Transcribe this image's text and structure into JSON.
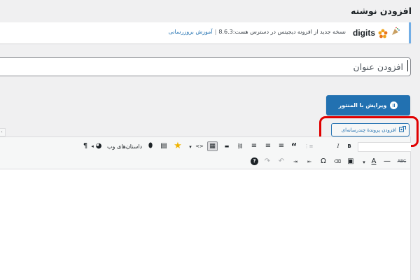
{
  "page": {
    "title": "افزودن نوشته"
  },
  "notice": {
    "brand": "digits",
    "message": "نسخه جدید از افزونه دیجیتس در دسترس هست:8.6.3",
    "separator": "|",
    "link": "آموزش بروزرسانی"
  },
  "title_field": {
    "placeholder": "افزودن عنوان"
  },
  "elementor": {
    "label": "ویرایش با المنتور"
  },
  "media": {
    "label": "افزودن پروندهٔ چندرسانه‌ای"
  },
  "toolbar": {
    "row1": [
      {
        "name": "paragraph-icon",
        "glyph": "¶"
      },
      {
        "name": "rtl-icon",
        "glyph": "◂"
      },
      {
        "name": "pie-chart-icon",
        "glyph": "◕"
      },
      {
        "name": "web-stories-label",
        "text": "داستان‌های وب"
      },
      {
        "name": "web-stories-icon",
        "glyph": "⬮"
      },
      {
        "name": "table-icon",
        "glyph": "▤"
      },
      {
        "name": "star-icon",
        "glyph": "★"
      },
      {
        "name": "dropdown-arrow-icon",
        "glyph": "▾"
      },
      {
        "name": "code-icon",
        "glyph": "<>"
      },
      {
        "name": "toolbar-toggle-icon",
        "glyph": "▦"
      },
      {
        "name": "read-more-icon",
        "glyph": "▬"
      },
      {
        "name": "link-icon",
        "glyph": "⛓"
      },
      {
        "name": "align-right-icon",
        "glyph": "≡"
      },
      {
        "name": "align-center-icon",
        "glyph": "≡"
      },
      {
        "name": "align-left-icon",
        "glyph": "≡"
      },
      {
        "name": "blockquote-icon",
        "glyph": "“"
      },
      {
        "name": "numbered-list-icon",
        "glyph": "⋮≡"
      },
      {
        "name": "italic-icon",
        "glyph": "I"
      },
      {
        "name": "bold-icon",
        "glyph": "B"
      }
    ],
    "row2": [
      {
        "name": "strikethrough-icon",
        "glyph": "ABC"
      },
      {
        "name": "horizontal-line-icon",
        "glyph": "—"
      },
      {
        "name": "text-color-icon",
        "glyph": "A"
      },
      {
        "name": "text-color-dropdown-icon",
        "glyph": "▾"
      },
      {
        "name": "paste-text-icon",
        "glyph": "▣"
      },
      {
        "name": "clear-format-icon",
        "glyph": "⌫"
      },
      {
        "name": "special-char-icon",
        "glyph": "Ω"
      },
      {
        "name": "outdent-icon",
        "glyph": "⇤"
      },
      {
        "name": "indent-icon",
        "glyph": "⇥"
      },
      {
        "name": "undo-icon",
        "glyph": "↶"
      },
      {
        "name": "redo-icon",
        "glyph": "↷"
      },
      {
        "name": "help-icon",
        "glyph": "?"
      }
    ]
  },
  "colors": {
    "primary": "#2271b1",
    "highlight": "#e00000"
  }
}
